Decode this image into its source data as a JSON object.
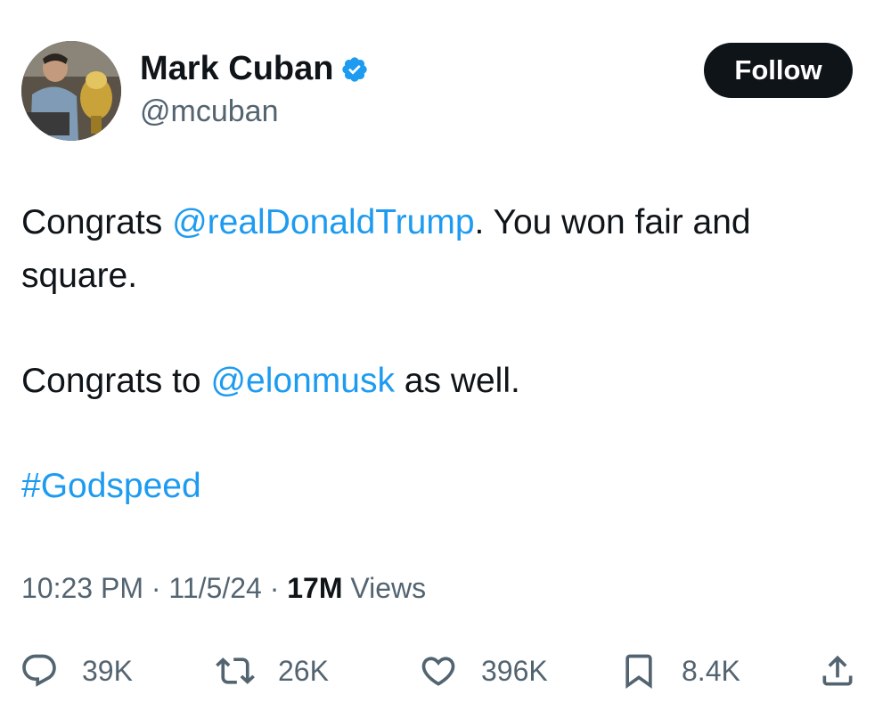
{
  "author": {
    "name": "Mark Cuban",
    "handle": "@mcuban",
    "verified": true
  },
  "follow_button": {
    "label": "Follow"
  },
  "tweet": {
    "line1_prefix": "Congrats ",
    "line1_mention": "@realDonaldTrump",
    "line1_suffix": ".  You won fair and",
    "line2": "square.",
    "line3_prefix": "Congrats to ",
    "line3_mention": "@elonmusk",
    "line3_suffix": " as well.",
    "hashtag": "#Godspeed"
  },
  "meta": {
    "time": "10:23 PM",
    "separator": " · ",
    "date": "11/5/24",
    "views_count": "17M",
    "views_label": " Views"
  },
  "actions": {
    "reply": {
      "icon": "reply-icon",
      "count": "39K"
    },
    "repost": {
      "icon": "repost-icon",
      "count": "26K"
    },
    "like": {
      "icon": "heart-icon",
      "count": "396K"
    },
    "bookmark": {
      "icon": "bookmark-icon",
      "count": "8.4K"
    },
    "share": {
      "icon": "share-icon"
    }
  },
  "colors": {
    "text": "#0f1419",
    "secondary": "#536471",
    "link": "#1d9bf0",
    "follow_bg": "#0f1419"
  }
}
